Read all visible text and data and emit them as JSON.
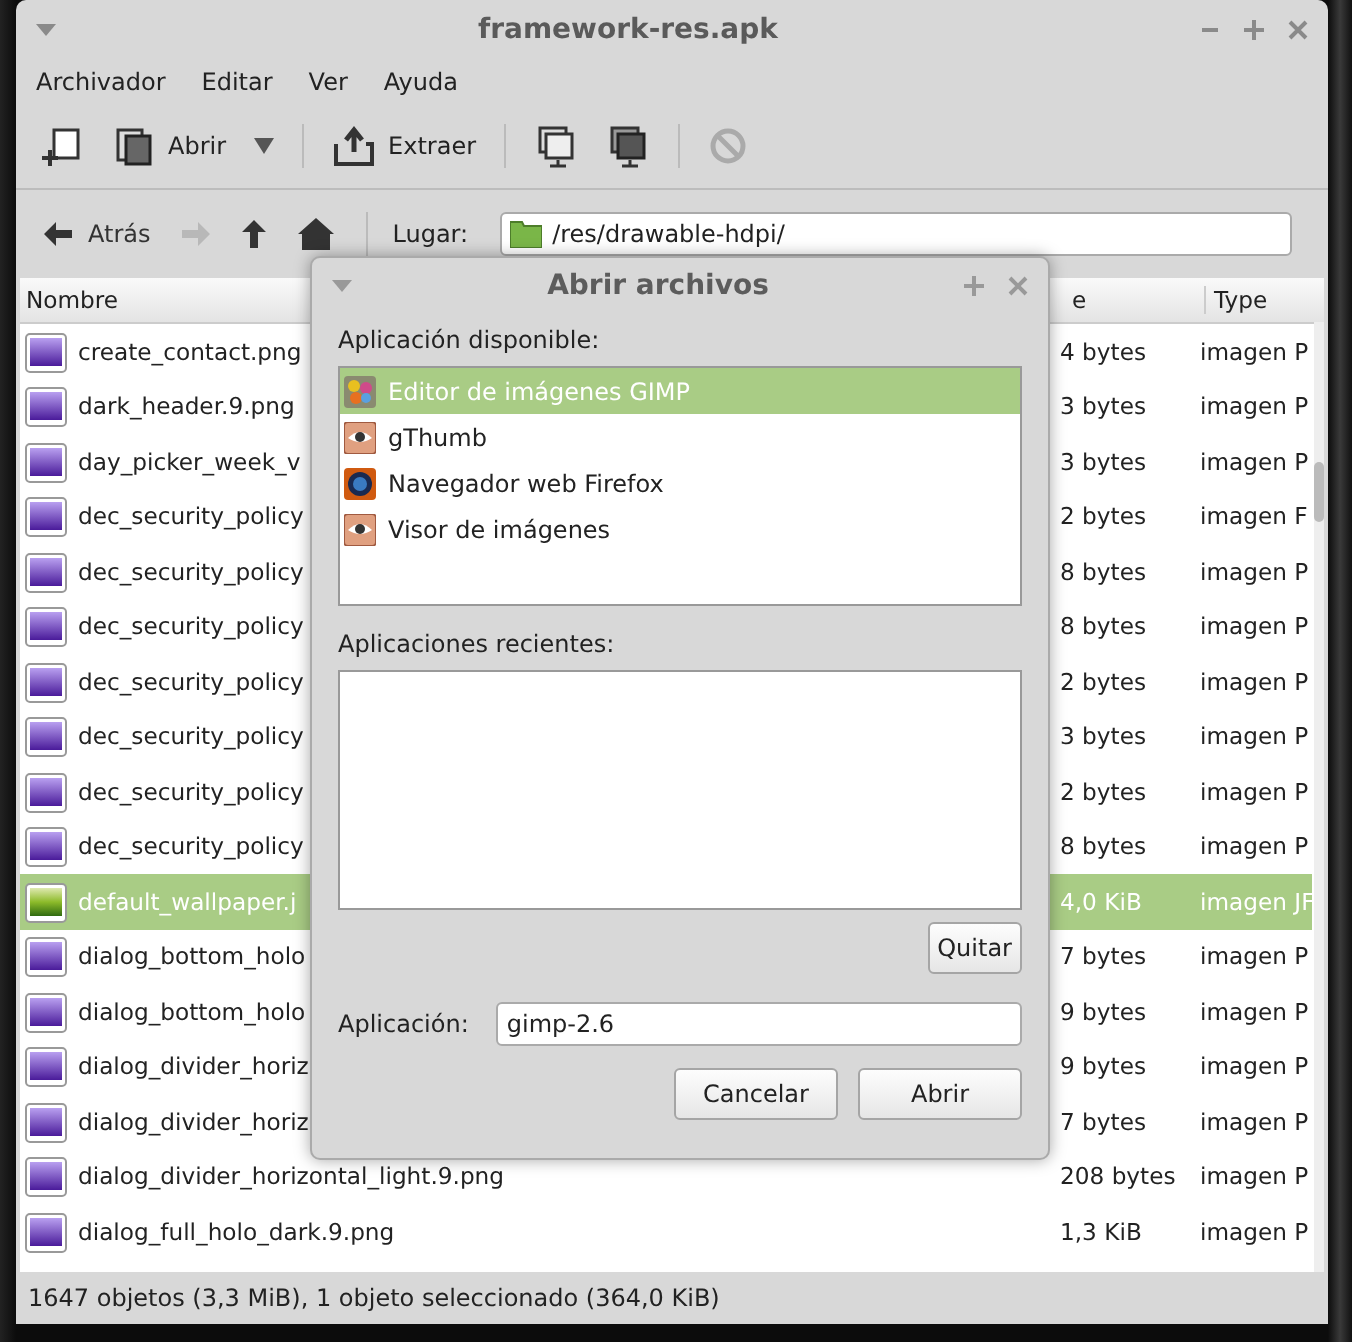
{
  "window": {
    "title": "framework-res.apk"
  },
  "menu": [
    "Archivador",
    "Editar",
    "Ver",
    "Ayuda"
  ],
  "toolbar": [
    {
      "kind": "new"
    },
    {
      "kind": "open",
      "label": "Abrir"
    },
    {
      "kind": "dropdown"
    },
    {
      "kind": "separator"
    },
    {
      "kind": "extract",
      "label": "Extraer"
    },
    {
      "kind": "separator"
    },
    {
      "kind": "copy"
    },
    {
      "kind": "paste"
    },
    {
      "kind": "separator"
    },
    {
      "kind": "stop",
      "disabled": true
    }
  ],
  "nav": [
    {
      "kind": "back",
      "label": "Atrás",
      "disabled": false
    },
    {
      "kind": "forward",
      "disabled": true
    },
    {
      "kind": "up",
      "disabled": false
    },
    {
      "kind": "home",
      "disabled": false
    }
  ],
  "location": {
    "label": "Lugar:",
    "value": "/res/drawable-hdpi/"
  },
  "table": {
    "columns": [
      "Nombre",
      "e",
      "Type"
    ],
    "rows": [
      {
        "name": "create_contact.png",
        "size": "4 bytes",
        "type": "imagen P",
        "kind": "png",
        "selected": false
      },
      {
        "name": "dark_header.9.png",
        "size": "3 bytes",
        "type": "imagen P",
        "kind": "png",
        "selected": false
      },
      {
        "name": "day_picker_week_v",
        "size": "3 bytes",
        "type": "imagen P",
        "kind": "png",
        "selected": false
      },
      {
        "name": "dec_security_policy",
        "size": "2 bytes",
        "type": "imagen F",
        "kind": "png",
        "selected": false
      },
      {
        "name": "dec_security_policy",
        "size": "8 bytes",
        "type": "imagen P",
        "kind": "png",
        "selected": false
      },
      {
        "name": "dec_security_policy",
        "size": "8 bytes",
        "type": "imagen P",
        "kind": "png",
        "selected": false
      },
      {
        "name": "dec_security_policy",
        "size": "2 bytes",
        "type": "imagen P",
        "kind": "png",
        "selected": false
      },
      {
        "name": "dec_security_policy",
        "size": "3 bytes",
        "type": "imagen P",
        "kind": "png",
        "selected": false
      },
      {
        "name": "dec_security_policy",
        "size": "2 bytes",
        "type": "imagen P",
        "kind": "png",
        "selected": false
      },
      {
        "name": "dec_security_policy",
        "size": "8 bytes",
        "type": "imagen P",
        "kind": "png",
        "selected": false
      },
      {
        "name": "default_wallpaper.j",
        "size": "4,0 KiB",
        "type": "imagen JF",
        "kind": "jpg",
        "selected": true
      },
      {
        "name": "dialog_bottom_holo",
        "size": "7 bytes",
        "type": "imagen P",
        "kind": "png",
        "selected": false
      },
      {
        "name": "dialog_bottom_holo",
        "size": "9 bytes",
        "type": "imagen P",
        "kind": "png",
        "selected": false
      },
      {
        "name": "dialog_divider_horiz",
        "size": "9 bytes",
        "type": "imagen P",
        "kind": "png",
        "selected": false
      },
      {
        "name": "dialog_divider_horiz",
        "size": "7 bytes",
        "type": "imagen P",
        "kind": "png",
        "selected": false
      },
      {
        "name": "dialog_divider_horizontal_light.9.png",
        "size": "208 bytes",
        "type": "imagen P",
        "kind": "png",
        "selected": false
      },
      {
        "name": "dialog_full_holo_dark.9.png",
        "size": "1,3 KiB",
        "type": "imagen P",
        "kind": "png",
        "selected": false
      }
    ]
  },
  "status_bar": "1647 objetos (3,3 MiB), 1 objeto seleccionado (364,0 KiB)",
  "dialog": {
    "title": "Abrir archivos",
    "available_label": "Aplicación disponible:",
    "available": [
      {
        "name": "Editor de imágenes GIMP",
        "kind": "gimp",
        "selected": true
      },
      {
        "name": "gThumb",
        "kind": "viewer",
        "selected": false
      },
      {
        "name": "Navegador web Firefox",
        "kind": "browser",
        "selected": false
      },
      {
        "name": "Visor de imágenes",
        "kind": "viewer",
        "selected": false
      }
    ],
    "recent_label": "Aplicaciones recientes:",
    "remove_button": "Quitar",
    "app_label": "Aplicación:",
    "app_value": "gimp-2.6",
    "buttons": [
      "Cancelar",
      "Abrir"
    ]
  }
}
